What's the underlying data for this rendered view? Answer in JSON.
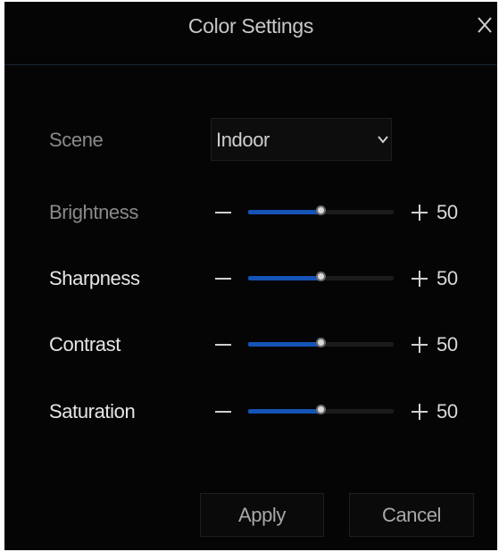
{
  "dialog": {
    "title": "Color Settings",
    "close_icon": "close-icon"
  },
  "scene": {
    "label": "Scene",
    "value": "Indoor",
    "icon": "chevron-down-icon"
  },
  "sliders": [
    {
      "label": "Brightness",
      "value": "50",
      "level": 0.5,
      "minus_icon": "minus-icon",
      "plus_icon": "plus-icon"
    },
    {
      "label": "Sharpness",
      "value": "50",
      "level": 0.5,
      "minus_icon": "minus-icon",
      "plus_icon": "plus-icon"
    },
    {
      "label": "Contrast",
      "value": "50",
      "level": 0.5,
      "minus_icon": "minus-icon",
      "plus_icon": "plus-icon"
    },
    {
      "label": "Saturation",
      "value": "50",
      "level": 0.5,
      "minus_icon": "minus-icon",
      "plus_icon": "plus-icon"
    }
  ],
  "buttons": {
    "apply": "Apply",
    "cancel": "Cancel"
  },
  "colors": {
    "background": "#050505",
    "accent": "#1553b6",
    "track": "#1b1b1b",
    "text": "#e6e6e6"
  }
}
